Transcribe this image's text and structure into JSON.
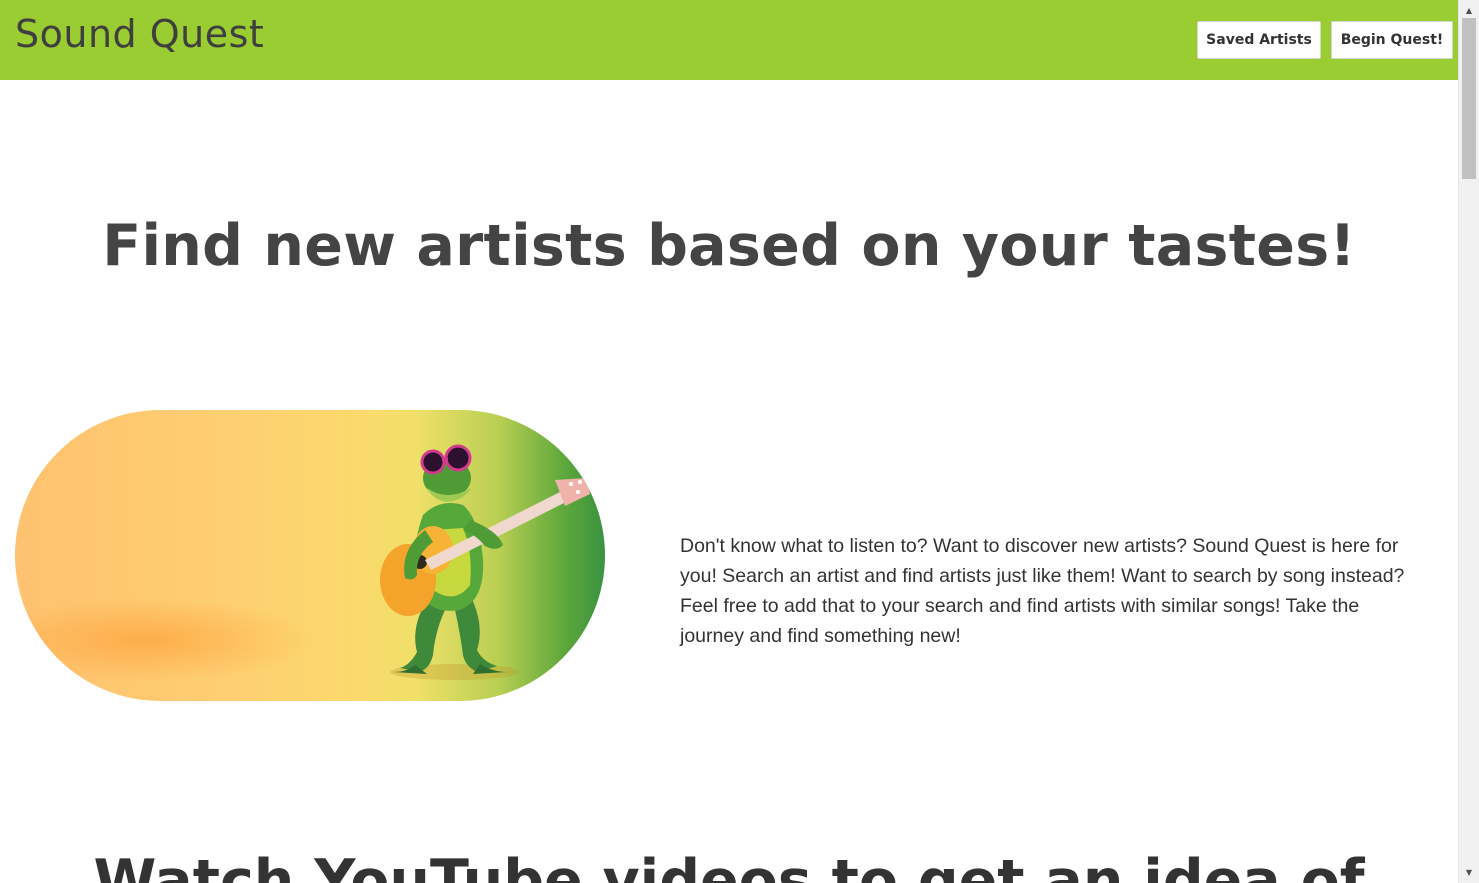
{
  "header": {
    "brand": "Sound Quest",
    "saved_artists_label": "Saved Artists",
    "begin_quest_label": "Begin Quest!",
    "background_color": "#9acd32"
  },
  "hero": {
    "title": "Find new artists based on your tastes!",
    "image_alt": "Frog wearing sunglasses playing a guitar",
    "description": "Don't know what to listen to? Want to discover new artists? Sound Quest is here for you! Search an artist and find artists just like them! Want to search by song instead? Feel free to add that to your search and find artists with similar songs! Take the journey and find something new!"
  },
  "next_section": {
    "title": "Watch YouTube videos to get an idea of"
  },
  "scrollbar": {
    "up_icon": "triangle-up-icon",
    "down_icon": "triangle-down-icon"
  }
}
